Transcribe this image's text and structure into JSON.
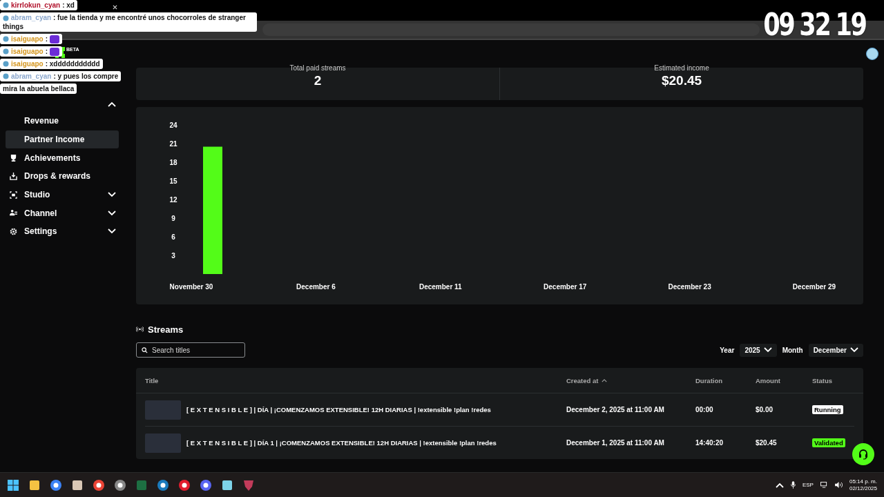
{
  "chat": [
    {
      "user": "kirrlokun_cyan",
      "color": "#b0102a",
      "text": ": xd",
      "emote": false
    },
    {
      "user": "abram_cyan",
      "color": "#8aa6cc",
      "text": ": fue la tienda y me encontré unos chocorroles de stranger things",
      "emote": false
    },
    {
      "user": "isaiguapo",
      "color": "#d4951c",
      "text": ":",
      "emote": true
    },
    {
      "user": "isaiguapo",
      "color": "#d4951c",
      "text": ":",
      "emote": true
    },
    {
      "user": "isaiguapo",
      "color": "#d4951c",
      "text": ": xddddddddddd",
      "emote": false
    },
    {
      "user": "abram_cyan",
      "color": "#8aa6cc",
      "text": ": y pues los compre",
      "emote": false
    },
    {
      "text": "mira la abuela bellaca",
      "emote": false
    }
  ],
  "timer": [
    "09",
    "32",
    "19"
  ],
  "logo": {
    "badge": "BETA"
  },
  "sidebar": {
    "section_expanded": true,
    "items": [
      {
        "label": "Revenue",
        "kind": "sub",
        "selected": false
      },
      {
        "label": "Partner Income",
        "kind": "sub",
        "selected": true
      },
      {
        "label": "Achievements",
        "kind": "trophy",
        "selected": false
      },
      {
        "label": "Drops & rewards",
        "kind": "drops",
        "selected": false
      },
      {
        "label": "Studio",
        "kind": "studio",
        "selected": false,
        "expanded": false
      },
      {
        "label": "Channel",
        "kind": "channel",
        "selected": false,
        "expanded": false
      },
      {
        "label": "Settings",
        "kind": "settings",
        "selected": false,
        "expanded": false
      }
    ]
  },
  "stats": [
    {
      "label": "Total paid streams",
      "value": "2"
    },
    {
      "label": "Estimated income",
      "value": "$20.45"
    }
  ],
  "chart_data": {
    "type": "bar",
    "categories": [
      "November 30",
      "December 6",
      "December 11",
      "December 17",
      "December 23",
      "December 29"
    ],
    "series": [
      {
        "color": "#53fc18",
        "values": [
          20.5,
          null,
          null,
          null,
          null,
          null
        ]
      }
    ],
    "ylim": [
      0,
      24
    ],
    "yticks": [
      3,
      6,
      9,
      12,
      15,
      18,
      21,
      24
    ]
  },
  "streams": {
    "title": "Streams",
    "search": {
      "placeholder": "Search titles"
    },
    "year": {
      "label": "Year",
      "value": "2025"
    },
    "month": {
      "label": "Month",
      "value": "December"
    },
    "columns": [
      "Title",
      "Created at",
      "Duration",
      "Amount",
      "Status"
    ],
    "rows": [
      {
        "title": "[ E X T E N S I B L E ] | DÍA  | ¡COMENZAMOS EXTENSIBLE! 12H DIARIAS | !extensible !plan !redes",
        "created": "December 2, 2025 at 11:00 AM",
        "duration": "00:00",
        "amount": "$0.00",
        "status": "Running",
        "kind": "running"
      },
      {
        "title": "[ E X T E N S I B L E ] | DÍA 1 | ¡COMENZAMOS EXTENSIBLE! 12H DIARIAS | !extensible !plan !redes",
        "created": "December 1, 2025 at 11:00 AM",
        "duration": "14:40:20",
        "amount": "$20.45",
        "status": "Validated",
        "kind": "validated"
      }
    ]
  },
  "taskbar": {
    "language": "ESP",
    "time": "05:14 p. m.",
    "date": "02/12/2025"
  }
}
